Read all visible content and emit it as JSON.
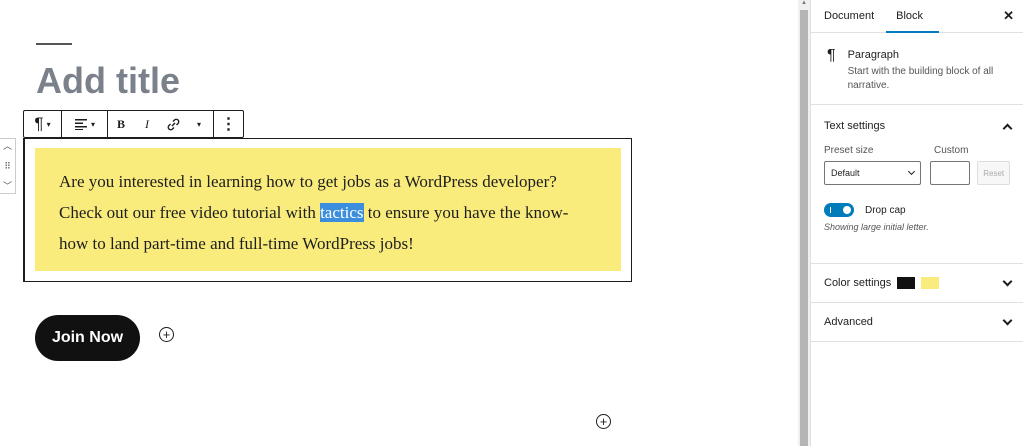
{
  "editor": {
    "title_placeholder": "Add title",
    "paragraph": {
      "before": "Are you interested in learning how to get jobs as a WordPress developer? Check out our free video tutorial with ",
      "highlight": "tactics",
      "after": " to ensure you have the know-how to land part-time and full-time WordPress jobs!"
    },
    "button_label": "Join Now",
    "toolbar": {
      "paragraph_glyph": "¶",
      "bold": "B",
      "italic": "I",
      "more": "⋮"
    }
  },
  "sidebar": {
    "tabs": [
      {
        "label": "Document"
      },
      {
        "label": "Block"
      }
    ],
    "active_tab": "Block",
    "close_glyph": "✕",
    "block_card": {
      "icon": "¶",
      "title": "Paragraph",
      "description": "Start with the building block of all narrative."
    },
    "text_settings": {
      "title": "Text settings",
      "preset_label": "Preset size",
      "custom_label": "Custom",
      "preset_value": "Default",
      "reset_label": "Reset",
      "drop_cap_label": "Drop cap",
      "drop_cap_help": "Showing large initial letter."
    },
    "color_settings": {
      "title": "Color settings",
      "text_color": "#111111",
      "background_color": "#f9ec7c"
    },
    "advanced": {
      "title": "Advanced"
    }
  }
}
